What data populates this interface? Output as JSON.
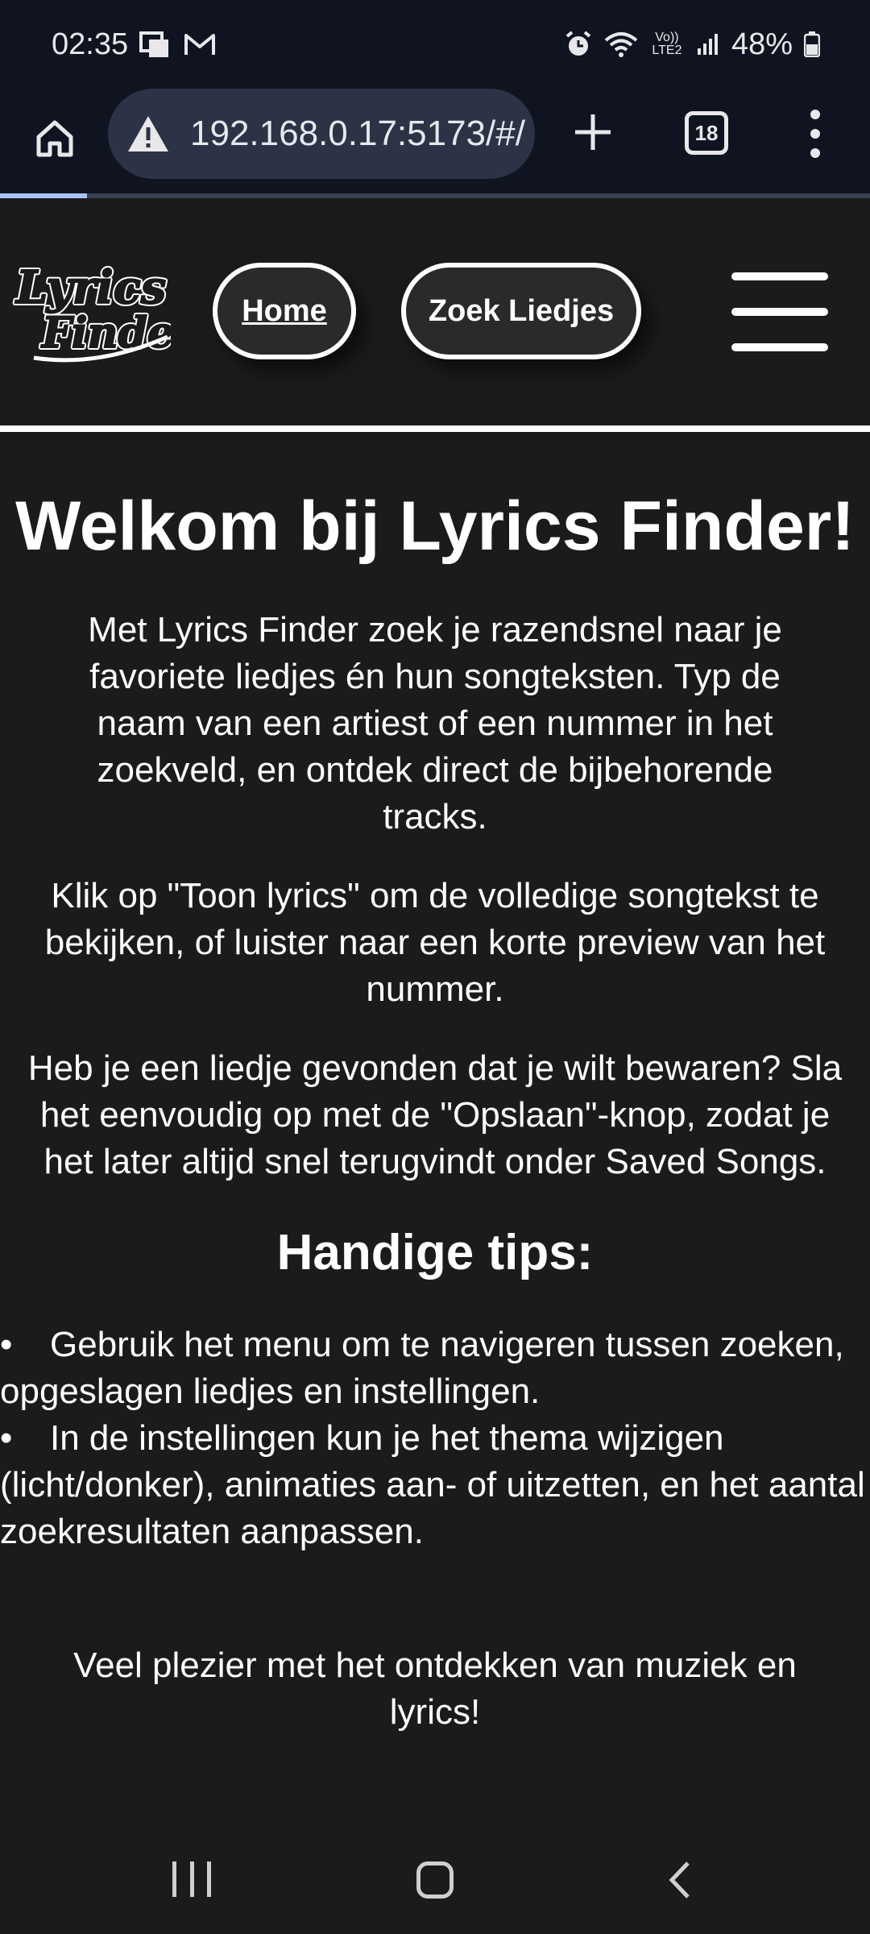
{
  "status_bar": {
    "time": "02:35",
    "icons_left": [
      "notification-icon",
      "mail-icon"
    ],
    "icons_right": [
      "alarm-icon",
      "wifi-icon",
      "volte-icon",
      "signal-icon"
    ],
    "volte_label": "Vo)) LTE2",
    "battery": "48%"
  },
  "browser": {
    "url": "192.168.0.17:5173/#/",
    "tab_count": "18",
    "load_progress": 0.1
  },
  "header": {
    "logo_text": "Lyrics Finder",
    "nav_home": "Home",
    "nav_search": "Zoek Liedjes"
  },
  "main": {
    "title": "Welkom bij Lyrics Finder!",
    "intro": "Met Lyrics Finder zoek je razendsnel naar je favoriete liedjes én hun songteksten. Typ de naam van een artiest of een nummer in het zoekveld, en ontdek direct de bijbehorende tracks.",
    "lyrics_info": "Klik op \"Toon lyrics\" om de volledige songtekst te bekijken, of luister naar een korte preview van het nummer.",
    "save_info": "Heb je een liedje gevonden dat je wilt bewaren? Sla het eenvoudig op met de \"Opslaan\"-knop, zodat je het later altijd snel terugvindt onder Saved Songs.",
    "tips_title": "Handige tips:",
    "tips": [
      "Gebruik het menu om te navigeren tussen zoeken, opgeslagen liedjes en instellingen.",
      "In de instellingen kun je het thema wijzigen (licht/donker), animaties aan- of uitzetten, en het aantal zoekresultaten aanpassen."
    ],
    "closing": "Veel plezier met het ontdekken van muziek en lyrics!"
  },
  "colors": {
    "page_bg": "#1b1b1c",
    "browser_bg": "#0f1420",
    "url_field_bg": "#2c3346",
    "progress": "#a9c1f5",
    "text": "#ffffff"
  }
}
